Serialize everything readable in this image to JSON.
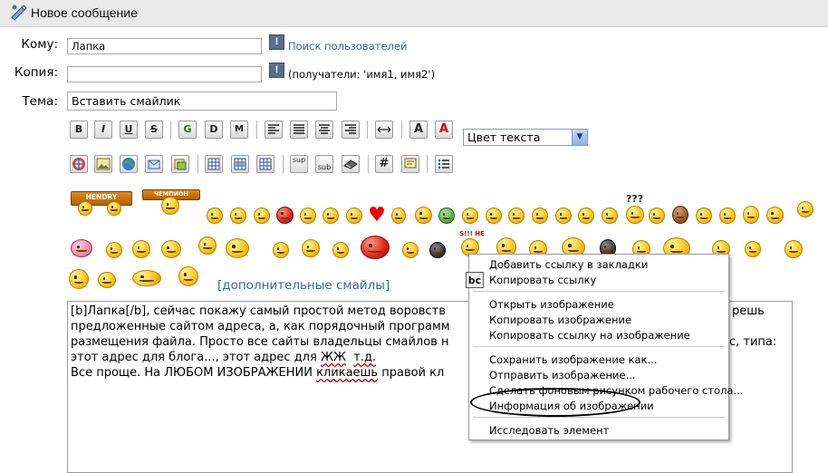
{
  "window": {
    "title": "Новое сообщение"
  },
  "form": {
    "to_label": "Кому:",
    "to_value": "Лапка",
    "search_users": "Поиск пользователей",
    "cc_label": "Копия:",
    "cc_value": "",
    "cc_note": "(получатели: 'имя1, имя2')",
    "subject_label": "Тема:",
    "subject_value": "Вставить смайлик",
    "info_icon_glyph": "!"
  },
  "toolbar": {
    "bold": "B",
    "italic": "I",
    "underline": "U",
    "strike": "S",
    "g": "G",
    "d": "D",
    "m": "M",
    "hash": "#",
    "sup": "sup",
    "sub": "sub",
    "font_size": "A",
    "font_color": "A",
    "color_select": "Цвет текста"
  },
  "smileys": {
    "banner_1": "HENDRY",
    "banner_2": "ЧЕМПИОН",
    "banner_3": "S!!! НЕ",
    "question": "???",
    "more_link": "[дополнительные смайлы]"
  },
  "message": {
    "l1a": "[b]Лапка[/b], сейчас покажу самый простой метод воровств",
    "l1b": "решь",
    "l2a": "предложенные сайтом адреса, а, как порядочный программ",
    "l3a": "размещения файла. Просто все сайты владельцы смайлов н",
    "l3b": "с, типа:",
    "l4a": "этот адрес для блога..., этот адрес для ",
    "l4u": "ЖЖ",
    "l4mid": "  ",
    "l4u2": "т.д.",
    "l5a": "Все проще. На ЛЮБОМ ИЗОБРАЖЕНИИ ",
    "l5u": "кликаешь",
    "l5b": " правой кл"
  },
  "context_menu": {
    "bc_icon": "bc",
    "items": [
      "Добавить ссылку в закладки",
      "Копировать ссылку",
      "Открыть изображение",
      "Копировать изображение",
      "Копировать ссылку на изображение",
      "Сохранить изображение как...",
      "Отправить изображение...",
      "Сделать фоновым рисунком рабочего стола...",
      "Информация об изображении",
      "Исследовать элемент"
    ]
  },
  "colors": {
    "link": "#3366a0",
    "title_bg": "#e9e9e9",
    "select_border": "#7f9db9"
  }
}
